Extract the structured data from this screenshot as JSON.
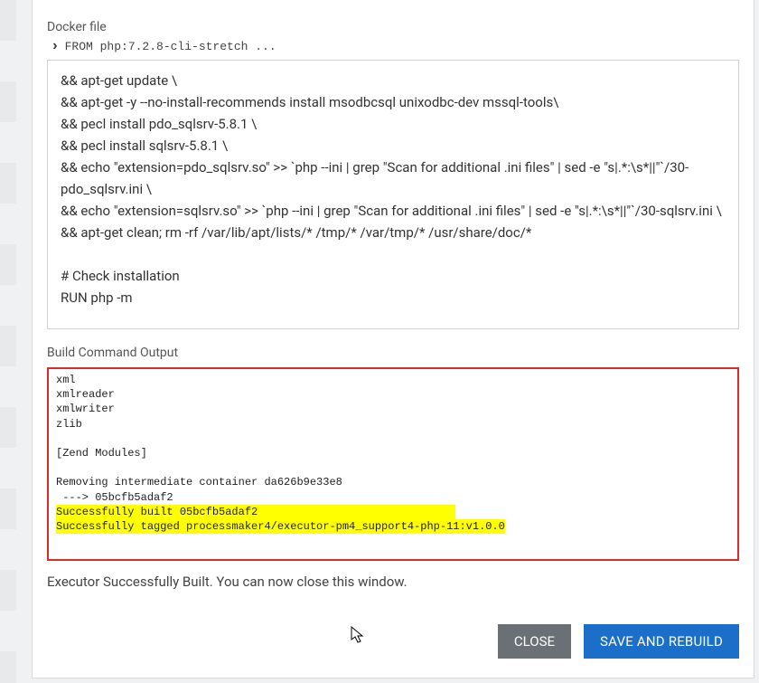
{
  "labels": {
    "docker_file": "Docker file",
    "from_line": "FROM php:7.2.8-cli-stretch ...",
    "build_output": "Build Command Output",
    "status": "Executor Successfully Built. You can now close this window."
  },
  "buttons": {
    "close": "CLOSE",
    "save_rebuild": "SAVE AND REBUILD"
  },
  "docker_text": "&& apt-get update \\\n&& apt-get -y --no-install-recommends install msodbcsql unixodbc-dev mssql-tools\\\n&& pecl install pdo_sqlsrv-5.8.1 \\\n&& pecl install sqlsrv-5.8.1 \\\n&& echo \"extension=pdo_sqlsrv.so\" >> `php --ini | grep \"Scan for additional .ini files\" | sed -e \"s|.*:\\s*||\"`/30-pdo_sqlsrv.ini \\\n&& echo \"extension=sqlsrv.so\" >> `php --ini | grep \"Scan for additional .ini files\" | sed -e \"s|.*:\\s*||\"`/30-sqlsrv.ini \\\n&& apt-get clean; rm -rf /var/lib/apt/lists/* /tmp/* /var/tmp/* /usr/share/doc/*\n\n# Check installation\nRUN php -m",
  "output_lines": [
    {
      "text": "xml"
    },
    {
      "text": "xmlreader"
    },
    {
      "text": "xmlwriter"
    },
    {
      "text": "zlib"
    },
    {
      "text": ""
    },
    {
      "text": "[Zend Modules]"
    },
    {
      "text": ""
    },
    {
      "text": "Removing intermediate container da626b9e33e8"
    },
    {
      "text": " ---> 05bcfb5adaf2"
    },
    {
      "text": "Successfully built 05bcfb5adaf2",
      "hl": true
    },
    {
      "text": "Successfully tagged processmaker4/executor-pm4_support4-php-11:v1.0.0",
      "hl": true
    }
  ],
  "colors": {
    "highlight": "#ffff00",
    "danger_border": "#d92c2c",
    "primary": "#1c6fc9",
    "secondary": "#6b7076"
  }
}
